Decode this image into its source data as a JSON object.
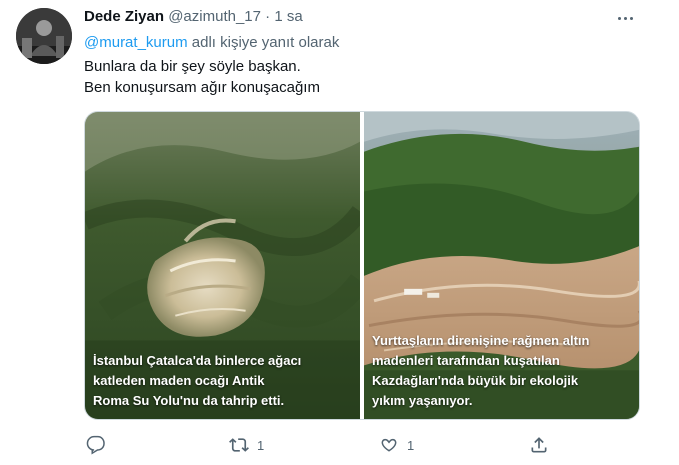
{
  "tweet": {
    "author_name": "Dede Ziyan",
    "author_handle": "@azimuth_17",
    "separator": "·",
    "time": "1 sa",
    "reply_mention": "@murat_kurum",
    "reply_suffix": " adlı kişiye yanıt olarak",
    "text_lines": [
      "Bunlara da bir şey söyle başkan.",
      "Ben konuşursam ağır konuşacağım"
    ],
    "media": [
      {
        "caption_lines": [
          "İstanbul Çatalca'da binlerce ağacı",
          "katleden maden ocağı Antik",
          "Roma Su Yolu'nu da tahrip etti."
        ]
      },
      {
        "caption_lines": [
          "Yurttaşların direnişine rağmen altın",
          "madenleri tarafından kuşatılan",
          "Kazdağları'nda büyük bir ekolojik",
          "yıkım yaşanıyor."
        ]
      }
    ],
    "actions": {
      "reply_icon": "reply-icon",
      "reply_count": "",
      "retweet_icon": "retweet-icon",
      "retweet_count": "1",
      "like_icon": "heart-icon",
      "like_count": "1",
      "share_icon": "share-icon"
    },
    "colors": {
      "link": "#1d9bf0",
      "muted": "#536471",
      "text": "#0f1419"
    }
  }
}
